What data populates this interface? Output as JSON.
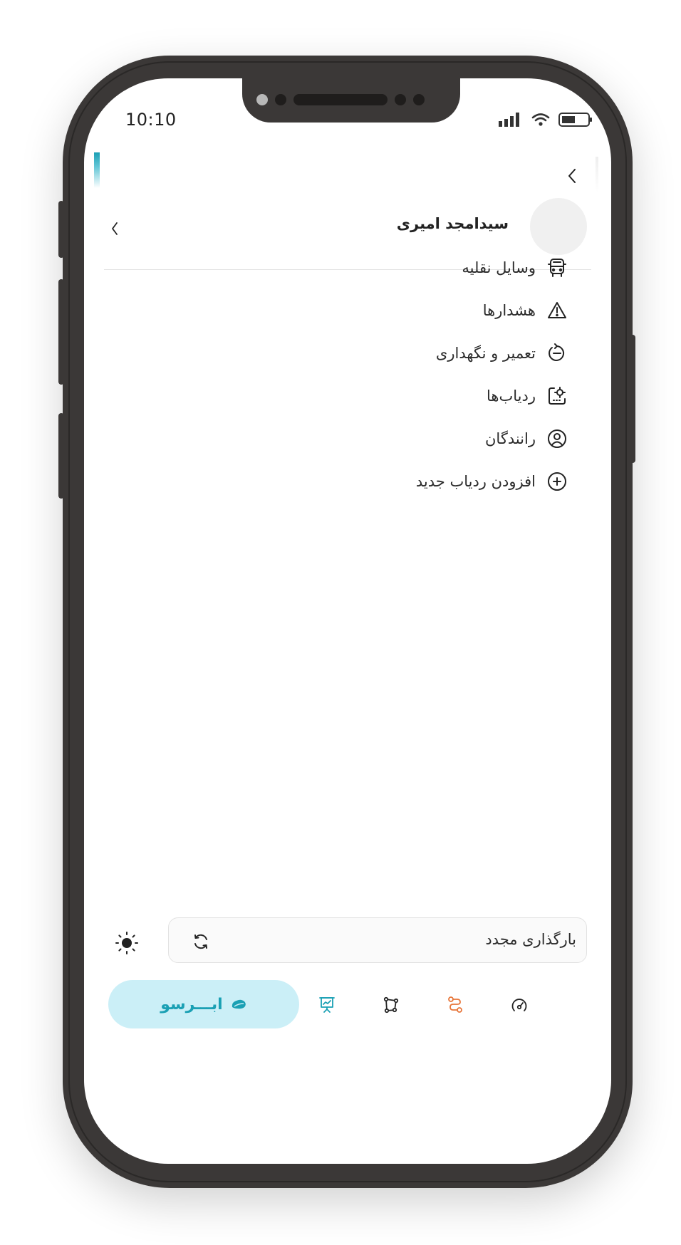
{
  "status_bar": {
    "time": "10:10"
  },
  "profile": {
    "name": "سیدامجد امیری"
  },
  "menu": {
    "items": [
      {
        "label": "وسایل نقلیه",
        "icon": "bus-icon"
      },
      {
        "label": "هشدارها",
        "icon": "warning-icon"
      },
      {
        "label": "تعمیر و نگهداری",
        "icon": "maintenance-icon"
      },
      {
        "label": "ردیاب‌ها",
        "icon": "tracker-icon"
      },
      {
        "label": "رانندگان",
        "icon": "driver-icon"
      },
      {
        "label": "افزودن ردیاب جدید",
        "icon": "add-circle-icon"
      }
    ]
  },
  "reload": {
    "label": "بارگذاری مجدد",
    "icon": "refresh-icon"
  },
  "theme_toggle": {
    "icon": "sun-icon"
  },
  "brand": {
    "label": "ابـــرسو",
    "icon": "cloud-leaf-icon",
    "color": "#1aa0b4"
  },
  "tabbar": {
    "icons": [
      "presentation-chart-icon",
      "polygon-icon",
      "route-icon",
      "gauge-icon"
    ],
    "accent_colors": {
      "teal": "#1aa0b4",
      "orange": "#e8763a"
    }
  }
}
